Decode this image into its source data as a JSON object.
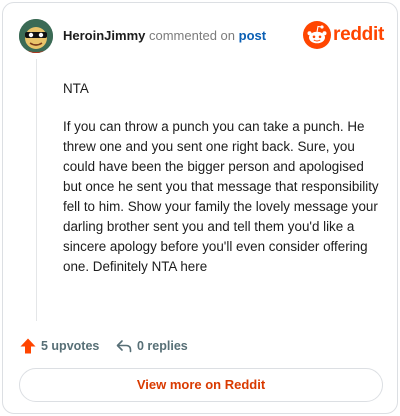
{
  "header": {
    "username": "HeroinJimmy",
    "action_text": "commented on",
    "post_link": "post",
    "brand_name": "reddit"
  },
  "comment": {
    "paragraphs": [
      "NTA",
      "If you can throw a punch you can take a punch. He threw one and you sent one right back. Sure, you could have been the bigger person and apologised but once he sent you that message that responsibility fell to him. Show your family the lovely message your darling brother sent you and tell them you'd like a sincere apology before you'll even consider offering one. Definitely NTA here"
    ]
  },
  "actions": {
    "upvotes": "5 upvotes",
    "replies": "0 replies"
  },
  "footer": {
    "view_more_label": "View more on Reddit"
  },
  "colors": {
    "brand": "#ff4500",
    "link": "#0a5fb4",
    "view_more_text": "#d93a00",
    "muted": "#576f76"
  },
  "icons": [
    "user-avatar",
    "reddit-snoo-icon",
    "upvote-arrow-icon",
    "reply-arrow-icon"
  ]
}
